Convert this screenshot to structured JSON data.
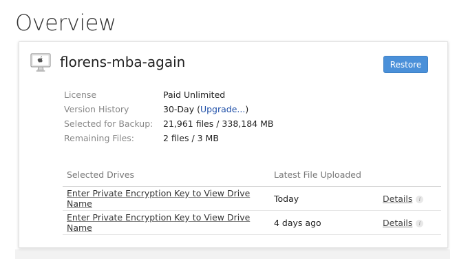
{
  "page": {
    "title": "Overview"
  },
  "device": {
    "name": "florens-mba-again",
    "icon": "computer-icon",
    "restore_label": "Restore"
  },
  "info": {
    "license_label": "License",
    "license_value": "Paid Unlimited",
    "version_label": "Version History",
    "version_value_prefix": "30-Day (",
    "version_upgrade_link": "Upgrade...",
    "version_value_suffix": ")",
    "selected_label": "Selected for Backup:",
    "selected_value": "21,961 files / 338,184 MB",
    "remaining_label": "Remaining Files:",
    "remaining_value": "2 files / 3 MB"
  },
  "drives": {
    "headers": {
      "name": "Selected Drives",
      "latest": "Latest File Uploaded"
    },
    "rows": [
      {
        "name": "Enter Private Encryption Key to View Drive Name",
        "latest": "Today",
        "details": "Details",
        "info_icon": "i"
      },
      {
        "name": "Enter Private Encryption Key to View Drive Name",
        "latest": "4 days ago",
        "details": "Details",
        "info_icon": "i"
      }
    ]
  },
  "colors": {
    "accent": "#4a90d9",
    "link": "#1f4fa8"
  }
}
